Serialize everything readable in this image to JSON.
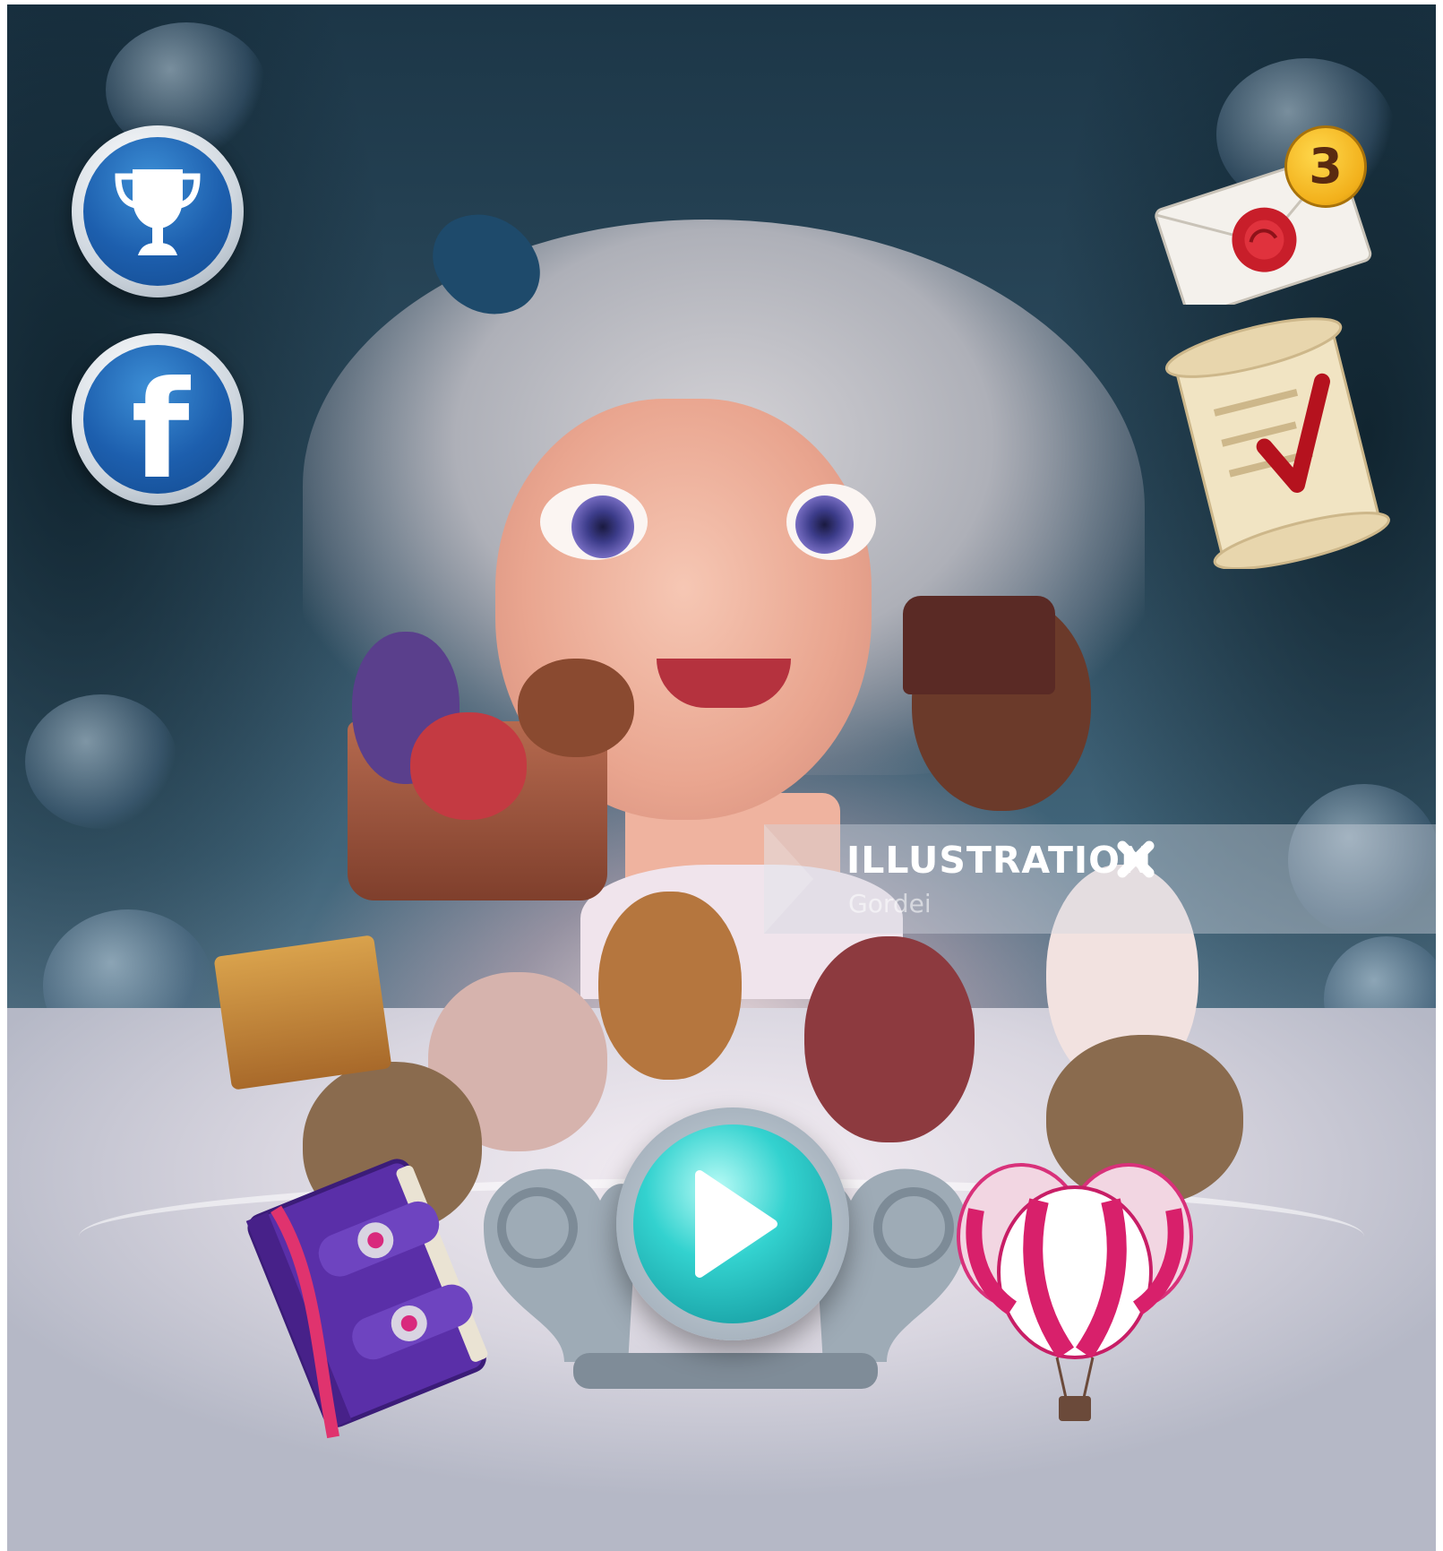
{
  "hud": {
    "trophy_icon": "trophy-icon",
    "facebook_icon": "facebook-icon",
    "facebook_letter": "f",
    "mail_icon": "sealed-envelope-icon",
    "mail_badge_count": "3",
    "quests_icon": "checklist-scroll-icon"
  },
  "main": {
    "play_icon": "play-icon",
    "book_icon": "spellbook-icon",
    "shop_icon": "hot-air-balloon-icon"
  },
  "overlay": {
    "title": "ILLUSTRATION",
    "author": "Gordei",
    "close_icon": "close-x-icon"
  },
  "colors": {
    "button_blue": "#1d5fae",
    "play_teal": "#33d2cf",
    "badge_gold": "#f2b01b",
    "seal_red": "#c81e2a"
  }
}
